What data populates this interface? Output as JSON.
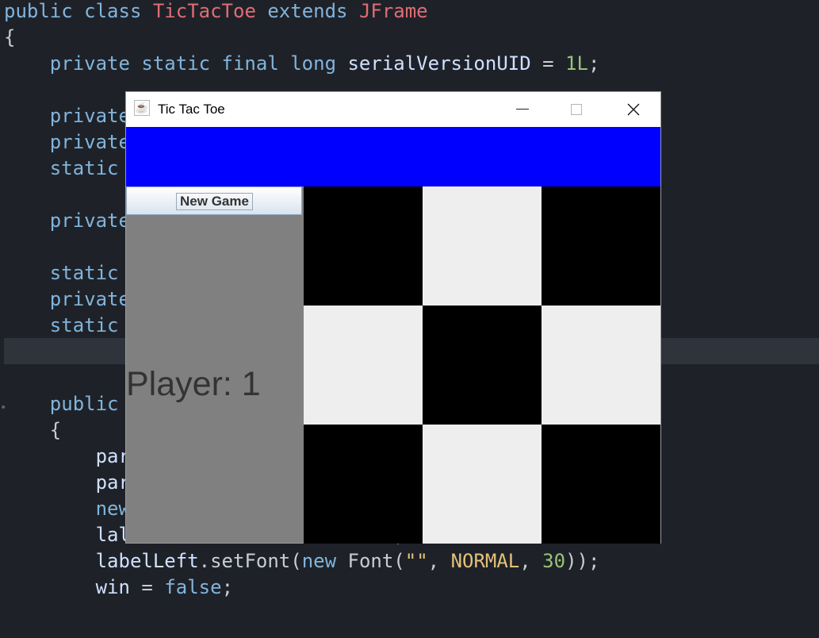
{
  "editor": {
    "lines": [
      [
        {
          "t": "public class ",
          "c": "kw"
        },
        {
          "t": "TicTacToe",
          "c": "cls"
        },
        {
          "t": " extends ",
          "c": "kw"
        },
        {
          "t": "JFrame",
          "c": "cls"
        }
      ],
      [
        {
          "t": "{",
          "c": "plain"
        }
      ],
      [
        {
          "t": "    private static final long ",
          "c": "kw"
        },
        {
          "t": "serialVersionUID",
          "c": "var"
        },
        {
          "t": " = ",
          "c": "plain"
        },
        {
          "t": "1L",
          "c": "num"
        },
        {
          "t": ";",
          "c": "plain"
        }
      ],
      [],
      [
        {
          "t": "    private",
          "c": "kw"
        }
      ],
      [
        {
          "t": "    private",
          "c": "kw"
        }
      ],
      [
        {
          "t": "    static",
          "c": "kw"
        }
      ],
      [],
      [
        {
          "t": "    private",
          "c": "kw"
        }
      ],
      [],
      [
        {
          "t": "    static",
          "c": "kw"
        },
        {
          "t": "                          \", \"\", \"\", \"\"}",
          "c": "str"
        }
      ],
      [
        {
          "t": "    private",
          "c": "kw"
        }
      ],
      [
        {
          "t": "    static",
          "c": "kw"
        }
      ],
      [],
      [],
      [
        {
          "t": "    public",
          "c": "kw"
        }
      ],
      [
        {
          "t": "    {",
          "c": "plain"
        }
      ],
      [
        {
          "t": "        par",
          "c": "var"
        }
      ],
      [
        {
          "t": "        par",
          "c": "var"
        }
      ],
      [
        {
          "t": "        new",
          "c": "kw"
        }
      ],
      [
        {
          "t": "        lal",
          "c": "var"
        },
        {
          "t": "                       ,",
          "c": "plain"
        }
      ],
      [
        {
          "t": "        labelLeft",
          "c": "var"
        },
        {
          "t": ".setFont(",
          "c": "plain"
        },
        {
          "t": "new",
          "c": "kw"
        },
        {
          "t": " Font(",
          "c": "plain"
        },
        {
          "t": "\"\"",
          "c": "str"
        },
        {
          "t": ", ",
          "c": "plain"
        },
        {
          "t": "NORMAL",
          "c": "const"
        },
        {
          "t": ", ",
          "c": "plain"
        },
        {
          "t": "30",
          "c": "num"
        },
        {
          "t": "));",
          "c": "plain"
        }
      ],
      [
        {
          "t": "        win",
          "c": "var"
        },
        {
          "t": " = ",
          "c": "plain"
        },
        {
          "t": "false",
          "c": "kw"
        },
        {
          "t": ";",
          "c": "plain"
        }
      ]
    ]
  },
  "window": {
    "title": "Tic Tac Toe",
    "app_icon": "java-icon",
    "controls": [
      "minimize-icon",
      "maximize-icon",
      "close-icon"
    ],
    "banner_color": "#0000ff",
    "left_panel": {
      "new_game_label": "New Game",
      "player_label": "Player: 1",
      "background": "#808080"
    },
    "board": {
      "rows": 3,
      "cols": 3,
      "cells": [
        "black",
        "light",
        "black",
        "light",
        "black",
        "light",
        "black",
        "light",
        "black"
      ],
      "colors": {
        "black": "#000000",
        "light": "#eeeeee"
      }
    }
  }
}
